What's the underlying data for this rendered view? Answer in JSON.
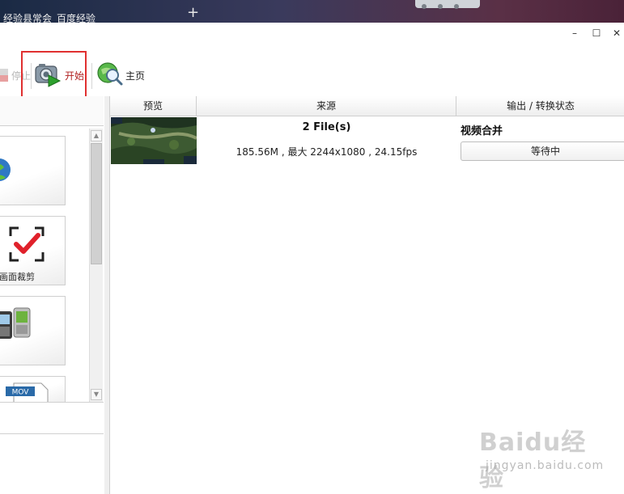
{
  "browser": {
    "tab_title": "经验县常会_百度经验",
    "new_tab": "+"
  },
  "window": {
    "minimize": "–",
    "maximize": "☐",
    "close": "✕"
  },
  "toolbar": {
    "stop_label": "停止",
    "start_label": "开始",
    "home_label": "主页",
    "highlight_color": "#e03030"
  },
  "left_panel": {
    "cards": [
      {
        "icon": "globe-icon",
        "label": ""
      },
      {
        "icon": "crop-icon",
        "label": "画面裁剪"
      },
      {
        "icon": "phones-icon",
        "label": ""
      },
      {
        "icon": "mov-file-icon",
        "label": "MOV"
      }
    ]
  },
  "table": {
    "columns": [
      "预览",
      "来源",
      "输出 / 转换状态"
    ],
    "rows": [
      {
        "source_files": "2 File(s)",
        "source_info": "185.56M , 最大 2244x1080 , 24.15fps",
        "output_task": "视频合并",
        "output_status": "等待中"
      }
    ]
  },
  "watermark": {
    "logo": "Baidu经验",
    "url": "jingyan.baidu.com"
  }
}
